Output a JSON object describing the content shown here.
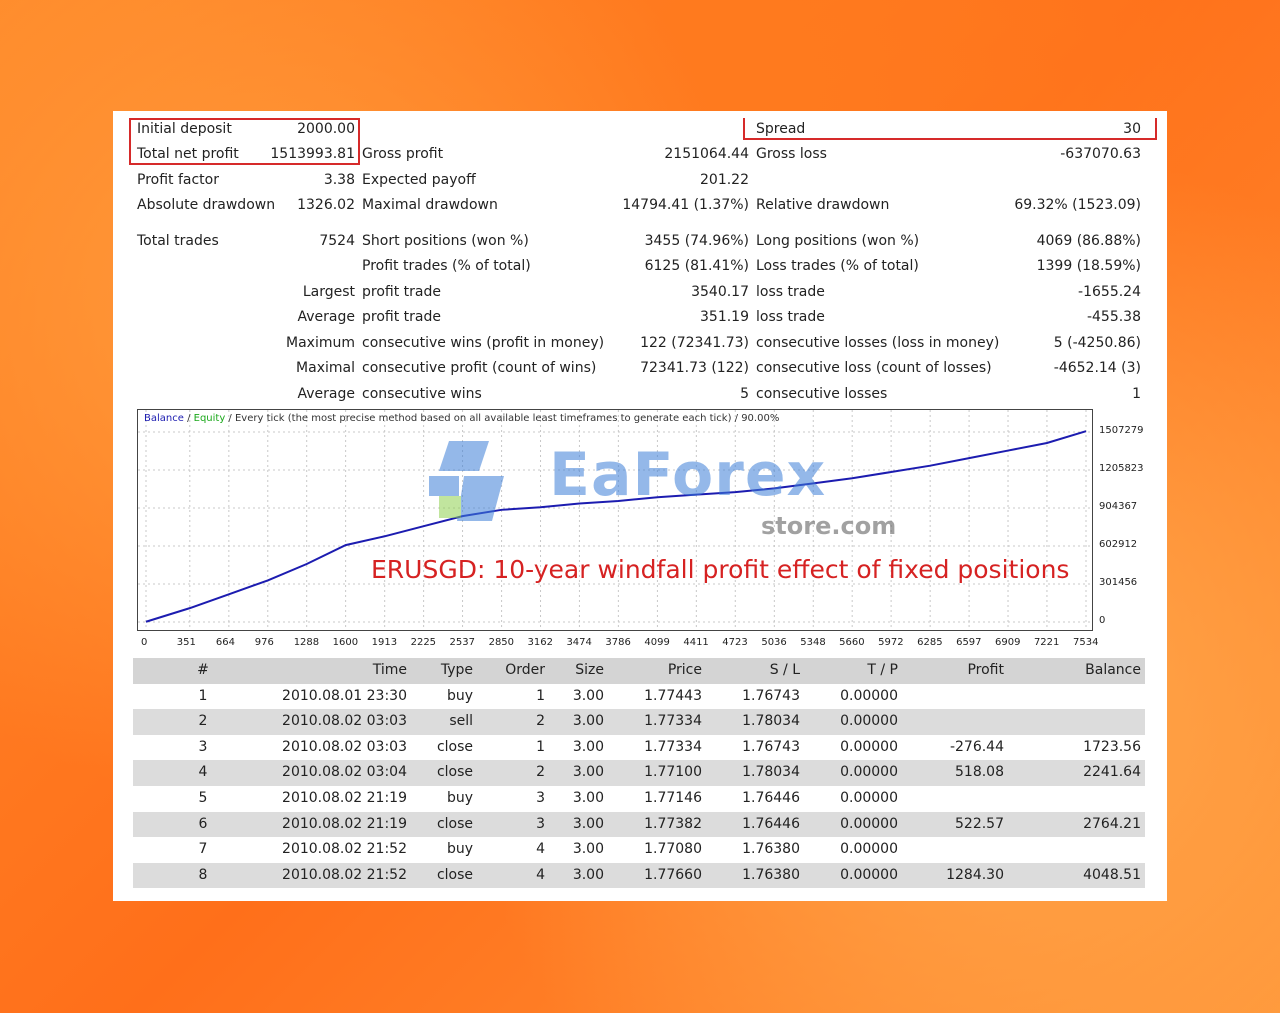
{
  "summary": {
    "initial_deposit_label": "Initial deposit",
    "initial_deposit": "2000.00",
    "spread_label": "Spread",
    "spread": "30",
    "total_net_profit_label": "Total net profit",
    "total_net_profit": "1513993.81",
    "gross_profit_label": "Gross profit",
    "gross_profit": "2151064.44",
    "gross_loss_label": "Gross loss",
    "gross_loss": "-637070.63",
    "profit_factor_label": "Profit factor",
    "profit_factor": "3.38",
    "expected_payoff_label": "Expected payoff",
    "expected_payoff": "201.22",
    "absolute_drawdown_label": "Absolute drawdown",
    "absolute_drawdown": "1326.02",
    "maximal_drawdown_label": "Maximal drawdown",
    "maximal_drawdown": "14794.41 (1.37%)",
    "relative_drawdown_label": "Relative drawdown",
    "relative_drawdown": "69.32% (1523.09)",
    "total_trades_label": "Total trades",
    "total_trades": "7524",
    "short_positions_label": "Short positions (won %)",
    "short_positions": "3455 (74.96%)",
    "long_positions_label": "Long positions (won %)",
    "long_positions": "4069 (86.88%)",
    "profit_trades_label": "Profit trades (% of total)",
    "profit_trades": "6125 (81.41%)",
    "loss_trades_label": "Loss trades (% of total)",
    "loss_trades": "1399 (18.59%)",
    "largest_label": "Largest",
    "largest_profit_label": "profit trade",
    "largest_profit": "3540.17",
    "largest_loss_label": "loss trade",
    "largest_loss": "-1655.24",
    "average_label": "Average",
    "average_profit_label": "profit trade",
    "average_profit": "351.19",
    "average_loss_label": "loss trade",
    "average_loss": "-455.38",
    "maximum_label": "Maximum",
    "max_consec_wins_label": "consecutive wins (profit in money)",
    "max_consec_wins": "122 (72341.73)",
    "max_consec_losses_label": "consecutive losses (loss in money)",
    "max_consec_losses": "5 (-4250.86)",
    "maximal_label": "Maximal",
    "maximal_consec_profit_label": "consecutive profit (count of wins)",
    "maximal_consec_profit": "72341.73 (122)",
    "maximal_consec_loss_label": "consecutive loss (count of losses)",
    "maximal_consec_loss": "-4652.14 (3)",
    "avg_consec_label": "Average",
    "avg_consec_wins_label": "consecutive wins",
    "avg_consec_wins": "5",
    "avg_consec_losses_label": "consecutive losses",
    "avg_consec_losses": "1"
  },
  "chart_legend": {
    "balance": "Balance",
    "sep1": " / ",
    "equity": "Equity",
    "rest": " / Every tick (the most precise method based on all available least timeframes to generate each tick) / 90.00%"
  },
  "watermark": {
    "brand": "EaForex",
    "sub": "store.com"
  },
  "caption": "ERUSGD: 10-year windfall profit effect of fixed positions",
  "colors": {
    "balance": "#1c1cb0",
    "equity": "#1aa81a",
    "highlight": "#d62a2a"
  },
  "chart_data": {
    "type": "line",
    "x": [
      0,
      351,
      664,
      976,
      1288,
      1600,
      1913,
      2225,
      2537,
      2850,
      3162,
      3474,
      3786,
      4099,
      4411,
      4723,
      5036,
      5348,
      5660,
      5972,
      6285,
      6597,
      6909,
      7221,
      7534
    ],
    "x_tick_labels": [
      "0",
      "351",
      "664",
      "976",
      "1288",
      "1600",
      "1913",
      "2225",
      "2537",
      "2850",
      "3162",
      "3474",
      "3786",
      "4099",
      "4411",
      "4723",
      "5036",
      "5348",
      "5660",
      "5972",
      "6285",
      "6597",
      "6909",
      "7221",
      "7534"
    ],
    "y_tick_labels": [
      "1507279",
      "1205823",
      "904367",
      "602912",
      "301456",
      "0"
    ],
    "y_ticks": [
      1507279,
      1205823,
      904367,
      602912,
      301456,
      0
    ],
    "ylim": [
      0,
      1507279
    ],
    "xlim": [
      0,
      7534
    ],
    "series": [
      {
        "name": "Balance",
        "values": [
          2000,
          110000,
          220000,
          330000,
          460000,
          610000,
          680000,
          760000,
          840000,
          890000,
          910000,
          940000,
          960000,
          990000,
          1010000,
          1030000,
          1060000,
          1100000,
          1140000,
          1190000,
          1240000,
          1300000,
          1360000,
          1420000,
          1513993
        ]
      }
    ],
    "grid": true
  },
  "table": {
    "headers": [
      "#",
      "Time",
      "Type",
      "Order",
      "Size",
      "Price",
      "S / L",
      "T / P",
      "Profit",
      "Balance"
    ],
    "rows": [
      [
        "1",
        "2010.08.01 23:30",
        "buy",
        "1",
        "3.00",
        "1.77443",
        "1.76743",
        "0.00000",
        "",
        ""
      ],
      [
        "2",
        "2010.08.02 03:03",
        "sell",
        "2",
        "3.00",
        "1.77334",
        "1.78034",
        "0.00000",
        "",
        ""
      ],
      [
        "3",
        "2010.08.02 03:03",
        "close",
        "1",
        "3.00",
        "1.77334",
        "1.76743",
        "0.00000",
        "-276.44",
        "1723.56"
      ],
      [
        "4",
        "2010.08.02 03:04",
        "close",
        "2",
        "3.00",
        "1.77100",
        "1.78034",
        "0.00000",
        "518.08",
        "2241.64"
      ],
      [
        "5",
        "2010.08.02 21:19",
        "buy",
        "3",
        "3.00",
        "1.77146",
        "1.76446",
        "0.00000",
        "",
        ""
      ],
      [
        "6",
        "2010.08.02 21:19",
        "close",
        "3",
        "3.00",
        "1.77382",
        "1.76446",
        "0.00000",
        "522.57",
        "2764.21"
      ],
      [
        "7",
        "2010.08.02 21:52",
        "buy",
        "4",
        "3.00",
        "1.77080",
        "1.76380",
        "0.00000",
        "",
        ""
      ],
      [
        "8",
        "2010.08.02 21:52",
        "close",
        "4",
        "3.00",
        "1.77660",
        "1.76380",
        "0.00000",
        "1284.30",
        "4048.51"
      ]
    ]
  }
}
